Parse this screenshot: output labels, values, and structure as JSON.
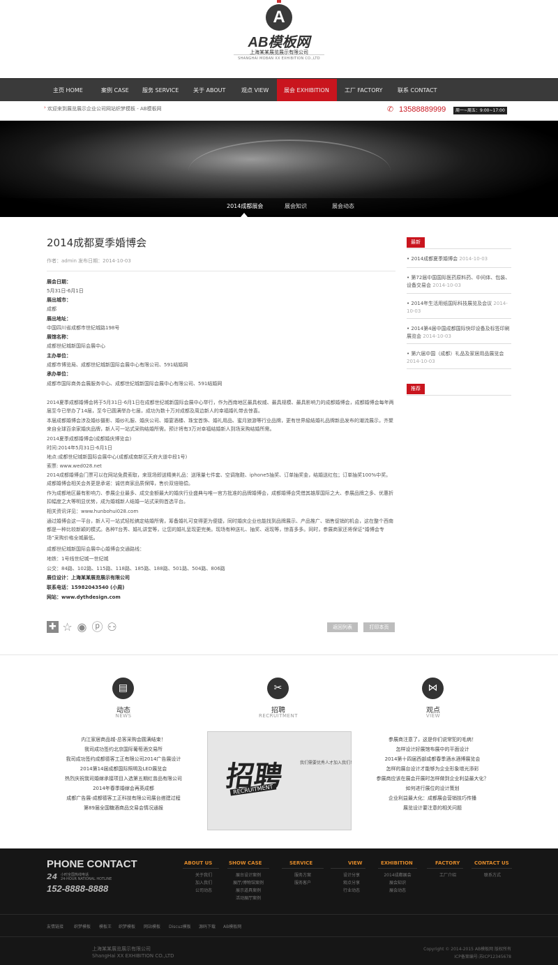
{
  "site": {
    "logo_letter": "A",
    "logo_text": "AB模板网",
    "company_cn": "上海某某展览展示有限公司",
    "company_en": "SHANGHAI MOBAN XX EXHIBITION CO.,LTD"
  },
  "nav": {
    "items": [
      {
        "label": "主页 HOME"
      },
      {
        "label": "案例 CASE"
      },
      {
        "label": "服务 SERVICE"
      },
      {
        "label": "关于 ABOUT"
      },
      {
        "label": "观点 VIEW"
      },
      {
        "label": "展会 EXHIBITION",
        "active": true
      },
      {
        "label": "工厂 FACTORY"
      },
      {
        "label": "联系 CONTACT"
      }
    ]
  },
  "subbar": {
    "welcome": "欢迎来到展览展示企业公司网站织梦模板 - AB模板网",
    "phone": "13588889999",
    "hours": "周一~周五：9:00~17:00"
  },
  "banner": {
    "tabs": [
      "2014成都展会",
      "展会知识",
      "展会动态"
    ],
    "active_tab": 0
  },
  "article": {
    "title": "2014成都夏季婚博会",
    "meta": "作者：admin    发布日期：2014-10-03",
    "fields": [
      {
        "label": "展会日期：",
        "value": "5月31日-6月1日"
      },
      {
        "label": "展出城市：",
        "value": "成都"
      },
      {
        "label": "展出地址：",
        "value": "中国四川省成都市世纪城路198号"
      },
      {
        "label": "展馆名称：",
        "value": "成都世纪城新国际会展中心"
      },
      {
        "label": "主办单位：",
        "value": "成都市博览局、成都世纪城新国际会展中心有限公司、591结婚网"
      },
      {
        "label": "承办单位：",
        "value": "成都市国际商务会展服务中心、成都世纪城新国际会展中心有限公司、591结婚网"
      }
    ],
    "paragraphs": [
      "2014夏季成都婚博会将于5月31日-6月1日在成都世纪城新国际会展中心举行，作为西南地区最具权威、最具规模、最具影响力的成都婚博会，成都婚博会每年两届至今已举办了14届，至今已圆满举办七届，成功为数十万对成都及周边新人的幸福婚礼带去惊喜。",
      "本届成都婚博会涉及婚纱摄影、婚纱礼服、婚庆公司、婚宴酒楼、珠宝首饰、婚礼用品、蜜月旅游等行业品牌，更有世界級結婚礼品牌新品发布的潮流展示，齐聚来自全球百余家婚庆品牌，新人可一站式采购结婚所需。预计将有3万对幸福结婚新人到场采购结婚所需。",
      "2014夏季成都婚博会(成都婚庆博览会)",
      "时间:2014年5月31日-6月1日",
      "地点:成都世纪城新国际会展中心(成都成南新区天府大道中段1号)",
      "索票: www.wed028.net",
      "2014成都婚博会门票可以在网站免费索取，来现场即送精美礼品：送限量七件套、空调拖鞋、iphone5抽奖、订单抽奖金，结婚送红包；订单抽奖100%中奖。成都婚博会相关会务更是承诺：诚信商家品质保障，售价双倍赔偿。",
      "作为成都地区最有影响力、参展企业最多、成交金额最大的婚庆行业盛典与唯一官方批准的品牌婚博会，成都婚博会凭借其雄厚国际之大、参展品牌之多、优惠折扣幅度之大等明显优势，成为婚城新人结婚一站式采购首选平台。",
      "相关资讯详见：www.hunbohui028.com",
      "通过婚博会这一平台，新人可一站式轻松搞定结婚所需，筹备婚礼可变得更为便捷，同时婚庆企业也能找到品牌展示、产品推广、销售促销的机会，这在整个西南都是一种比较新颖的模式。各种T台秀、婚礼讲堂等，让您的婚礼呈现更完美。现场有种送礼、抽奖、返现等，惊喜多多。同时，参展商家还将保证“婚博会专场”采购价格全城最低。",
      "成都世纪城新国际会展中心婚博会交通路线：",
      "地铁：1号线世纪城一世纪城",
      "公交：84路、102路、115路、118路、185路、188路、501路、504路、806路"
    ],
    "footer_fields": [
      {
        "label": "展位设计：",
        "value": "上海某某展览展示有限公司"
      },
      {
        "label": "联系电话：",
        "value": "15982043540 (小周)"
      },
      {
        "label": "网站：",
        "value": "www.dythdesign.com"
      }
    ],
    "share_icons": [
      "plus-icon",
      "star-icon",
      "weibo-icon",
      "pinterest-icon",
      "person-icon"
    ],
    "btn_back": "返回列表",
    "btn_print": "打印本页"
  },
  "sidebar": {
    "latest_label": "最新",
    "latest": [
      {
        "title": "2014成都夏季婚博会",
        "date": "2014-10-03"
      },
      {
        "title": "第72届中国国际医药原料药、中间体、包装、设备交易会",
        "date": "2014-10-03"
      },
      {
        "title": "2014年生活用纸国际科技展览及会议",
        "date": "2014-10-03"
      },
      {
        "title": "2014第4届中国成都国际快印设备及标签印刷展览会",
        "date": "2014-10-03"
      },
      {
        "title": "第六届中国（成都）礼品及家居用品展览会",
        "date": "2014-10-03"
      }
    ],
    "recommend_label": "推荐"
  },
  "sections": [
    {
      "icon": "news-icon",
      "cn": "动态",
      "en": "NEWS",
      "items": [
        "内江家居商品城-总客采购会圆满结束！",
        "我司成功签约北京国际葡萄酒交易所",
        "我司成功签约成都德客工正有限公司2014广告展设计",
        "2014第14届成都国际照明及LED展览会",
        "热烈庆祝我司婚嫁承接项目入选第五期红曾品有限公司",
        "2014年春季婚嫁会再英成都",
        "成都广告展-成都德客工正科技有限公司展台搭建过程",
        "第89届全国糖酒商品交易会情况通报"
      ]
    },
    {
      "icon": "recruit-icon",
      "cn": "招聘",
      "en": "RECRUITMENT",
      "image_text": "招聘",
      "image_en": "RECRUITMENT",
      "image_sub": "我们需要优秀人才加入我们！"
    },
    {
      "icon": "view-icon",
      "cn": "观点",
      "en": "VIEW",
      "items": [
        "参展商注意了，这是你们说常犯的毛病！",
        "怎样设计好展馆布展中的平面设计",
        "2014第十四届西部成都春季酒水酒博展览会",
        "怎样的展台设计才能够为企业形象增光添彩",
        "参展商应该在展会开展时怎样做到企业利益最大化？",
        "如何进行展位的设计策划",
        "企业利益最大化：成都展会营销技巧传播",
        "展览设计要注意的相关问题"
      ]
    }
  ],
  "footer": {
    "phone_title": "PHONE CONTACT",
    "h24": "24",
    "h24_cn": "小时全国热线电话",
    "h24_en": "24-HOUR NATIONAL HOTLINE",
    "phone": "152-8888-8888",
    "columns": [
      {
        "title": "ABOUT US",
        "links": [
          "关于我们",
          "加入我们",
          "公司动态"
        ]
      },
      {
        "title": "SHOW CASE",
        "links": [
          "展台设计案例",
          "展厅/博物馆案例",
          "展示道具案例",
          "活动展厅案例"
        ]
      },
      {
        "title": "SERVICE",
        "links": [
          "服务方案",
          "服务客户"
        ]
      },
      {
        "title": "VIEW",
        "links": [
          "设计分享",
          "观点分享",
          "行业动态"
        ]
      },
      {
        "title": "EXHIBITION",
        "links": [
          "2014成都展会",
          "展会知识",
          "展会动态"
        ]
      },
      {
        "title": "FACTORY",
        "links": [
          "工厂介绍"
        ]
      },
      {
        "title": "CONTACT US",
        "links": [
          "联系方式"
        ]
      }
    ],
    "friend_links": [
      "友情链接",
      "织梦模板",
      "模板王",
      "织梦模板",
      "网站模板",
      "Discuz模板",
      "源码下载",
      "AB模板网"
    ],
    "copy_company_cn": "上海某某展览展示有限公司",
    "copy_company_en": "ShangHai XX EXHIBITION CO.,LTD",
    "copyright": "Copyright © 2014-2015 AB模板网 版权所有",
    "icp": "ICP备案编号:苏ICP12345678"
  },
  "colors": {
    "brand_red": "#c9151e",
    "nav_bg": "#3a3a3a",
    "footer_bg": "#161616",
    "footer_heading": "#e08a2a"
  }
}
